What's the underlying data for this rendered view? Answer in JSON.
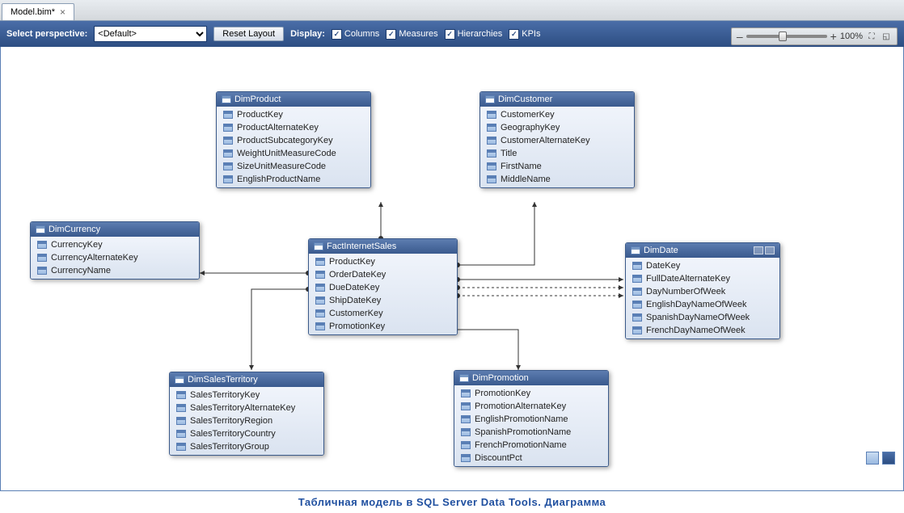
{
  "tab": {
    "name": "Model.bim*"
  },
  "toolbar": {
    "perspective_label": "Select perspective:",
    "perspective_value": "<Default>",
    "reset_layout": "Reset Layout",
    "display_label": "Display:",
    "checks": {
      "columns": "Columns",
      "measures": "Measures",
      "hierarchies": "Hierarchies",
      "kpis": "KPIs"
    }
  },
  "zoom": {
    "percent": "100%"
  },
  "entities": {
    "dimProduct": {
      "title": "DimProduct",
      "cols": [
        "ProductKey",
        "ProductAlternateKey",
        "ProductSubcategoryKey",
        "WeightUnitMeasureCode",
        "SizeUnitMeasureCode",
        "EnglishProductName"
      ]
    },
    "dimCustomer": {
      "title": "DimCustomer",
      "cols": [
        "CustomerKey",
        "GeographyKey",
        "CustomerAlternateKey",
        "Title",
        "FirstName",
        "MiddleName"
      ]
    },
    "dimCurrency": {
      "title": "DimCurrency",
      "cols": [
        "CurrencyKey",
        "CurrencyAlternateKey",
        "CurrencyName"
      ]
    },
    "factInternetSales": {
      "title": "FactInternetSales",
      "cols": [
        "ProductKey",
        "OrderDateKey",
        "DueDateKey",
        "ShipDateKey",
        "CustomerKey",
        "PromotionKey"
      ]
    },
    "dimDate": {
      "title": "DimDate",
      "cols": [
        "DateKey",
        "FullDateAlternateKey",
        "DayNumberOfWeek",
        "EnglishDayNameOfWeek",
        "SpanishDayNameOfWeek",
        "FrenchDayNameOfWeek"
      ]
    },
    "dimSalesTerritory": {
      "title": "DimSalesTerritory",
      "cols": [
        "SalesTerritoryKey",
        "SalesTerritoryAlternateKey",
        "SalesTerritoryRegion",
        "SalesTerritoryCountry",
        "SalesTerritoryGroup"
      ]
    },
    "dimPromotion": {
      "title": "DimPromotion",
      "cols": [
        "PromotionKey",
        "PromotionAlternateKey",
        "EnglishPromotionName",
        "SpanishPromotionName",
        "FrenchPromotionName",
        "DiscountPct"
      ]
    }
  },
  "caption": "Табличная модель в SQL Server Data Tools. Диаграмма"
}
